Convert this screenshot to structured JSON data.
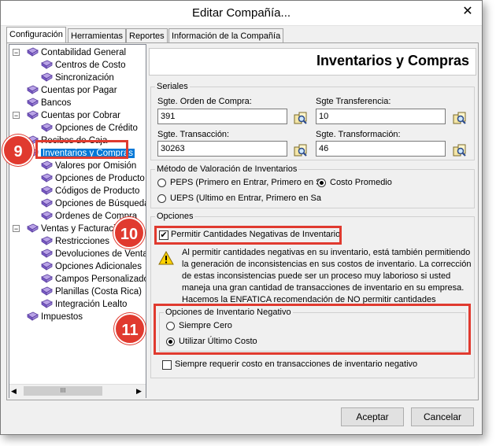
{
  "window": {
    "title": "Editar Compañía..."
  },
  "tabs": [
    "Configuración",
    "Herramientas",
    "Reportes",
    "Información de la Compañía"
  ],
  "tree": {
    "items": [
      {
        "label": "Contabilidad General",
        "level": 0,
        "expander": "−"
      },
      {
        "label": "Centros de Costo",
        "level": 1
      },
      {
        "label": "Sincronización",
        "level": 1
      },
      {
        "label": "Cuentas por Pagar",
        "level": 0
      },
      {
        "label": "Bancos",
        "level": 0
      },
      {
        "label": "Cuentas por Cobrar",
        "level": 0,
        "expander": "−"
      },
      {
        "label": "Opciones de Crédito",
        "level": 1
      },
      {
        "label": "Recibos de Caja",
        "level": 0
      },
      {
        "label": "Inventarios y Compras",
        "level": 0,
        "selected": true
      },
      {
        "label": "Valores por Omisión",
        "level": 1
      },
      {
        "label": "Opciones de Producto",
        "level": 1
      },
      {
        "label": "Códigos de Producto",
        "level": 1
      },
      {
        "label": "Opciones de Búsqueda",
        "level": 1
      },
      {
        "label": "Ordenes de Compra",
        "level": 1
      },
      {
        "label": "Ventas y Facturación",
        "level": 0,
        "expander": "−"
      },
      {
        "label": "Restricciones",
        "level": 1
      },
      {
        "label": "Devoluciones de Venta",
        "level": 1
      },
      {
        "label": "Opciones Adicionales",
        "level": 1
      },
      {
        "label": "Campos Personalizados",
        "level": 1
      },
      {
        "label": "Planillas (Costa Rica)",
        "level": 1
      },
      {
        "label": "Integración Lealto",
        "level": 1
      },
      {
        "label": "Impuestos",
        "level": 0
      }
    ],
    "scroll_thumb": "III"
  },
  "header": {
    "title": "Inventarios y Compras"
  },
  "seriales": {
    "legend": "Seriales",
    "orden_compra": {
      "label": "Sgte. Orden de Compra:",
      "value": "391"
    },
    "transferencia": {
      "label": "Sgte Transferencia:",
      "value": "10"
    },
    "transaccion": {
      "label": "Sgte. Transacción:",
      "value": "30263"
    },
    "transformacion": {
      "label": "Sgte. Transformación:",
      "value": "46"
    }
  },
  "valoracion": {
    "legend": "Método de Valoración de Inventarios",
    "peps": "PEPS (Primero en Entrar, Primero en S",
    "ueps": "UEPS (Ultimo en Entrar, Primero en Sa",
    "promedio": "Costo Promedio"
  },
  "opciones": {
    "legend": "Opciones",
    "permitir_negativas": "Permitir Cantidades Negativas de Inventario",
    "warning_lines": [
      "Al permitir cantidades negativas en su inventario, está también permitiendo",
      "la generación de inconsistencias en sus costos de inventario.  La corrección",
      "de estas inconsistencias puede ser un proceso muy laborioso si usted",
      "maneja una gran cantidad de transacciones de inventario en su empresa.",
      "Hacemos la ENFATICA recomendación de NO permitir cantidades"
    ],
    "negativo": {
      "legend": "Opciones de Inventario Negativo",
      "siempre_cero": "Siempre Cero",
      "ultimo_costo": "Utilizar Último Costo"
    },
    "requerir_costo": "Siempre requerir costo en transacciones de inventario negativo"
  },
  "buttons": {
    "accept": "Aceptar",
    "cancel": "Cancelar"
  },
  "badges": [
    "9",
    "10",
    "11"
  ],
  "colors": {
    "annotation_red": "#e03a2f",
    "selection_blue": "#0078d7"
  }
}
